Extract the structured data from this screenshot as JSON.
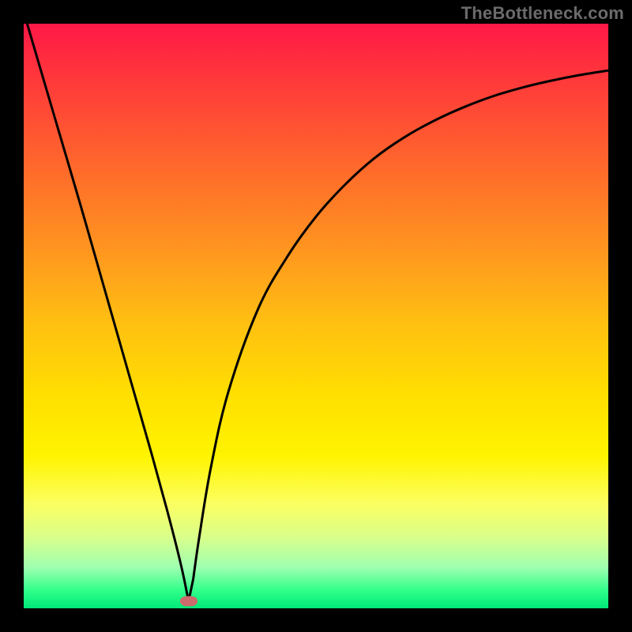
{
  "watermark": "TheBottleneck.com",
  "chart_data": {
    "type": "line",
    "title": "",
    "xlabel": "",
    "ylabel": "",
    "xlim": [
      0,
      100
    ],
    "ylim": [
      0,
      100
    ],
    "grid": false,
    "series": [
      {
        "name": "curve",
        "x": [
          0,
          5,
          10,
          14,
          18,
          22,
          25,
          27,
          28.2,
          29,
          30,
          32,
          35,
          40,
          45,
          50,
          55,
          60,
          65,
          70,
          75,
          80,
          85,
          90,
          95,
          100
        ],
        "values": [
          102,
          85,
          68,
          54,
          40,
          26,
          15,
          7,
          1.2,
          5,
          12,
          24,
          37,
          51,
          60,
          67,
          72.5,
          77,
          80.5,
          83.3,
          85.6,
          87.5,
          89,
          90.2,
          91.2,
          92
        ]
      }
    ],
    "marker": {
      "x": 28.2,
      "y": 1.2,
      "color": "#cc6b6b"
    },
    "background_gradient": {
      "top": "#ff1846",
      "bottom": "#00e878",
      "stops": [
        "#ff3a3a",
        "#ff6a2b",
        "#ff9a1e",
        "#ffc210",
        "#ffe000",
        "#fff400",
        "#fcff60",
        "#d8ff8c",
        "#9fffb0",
        "#2fff8a"
      ]
    }
  }
}
